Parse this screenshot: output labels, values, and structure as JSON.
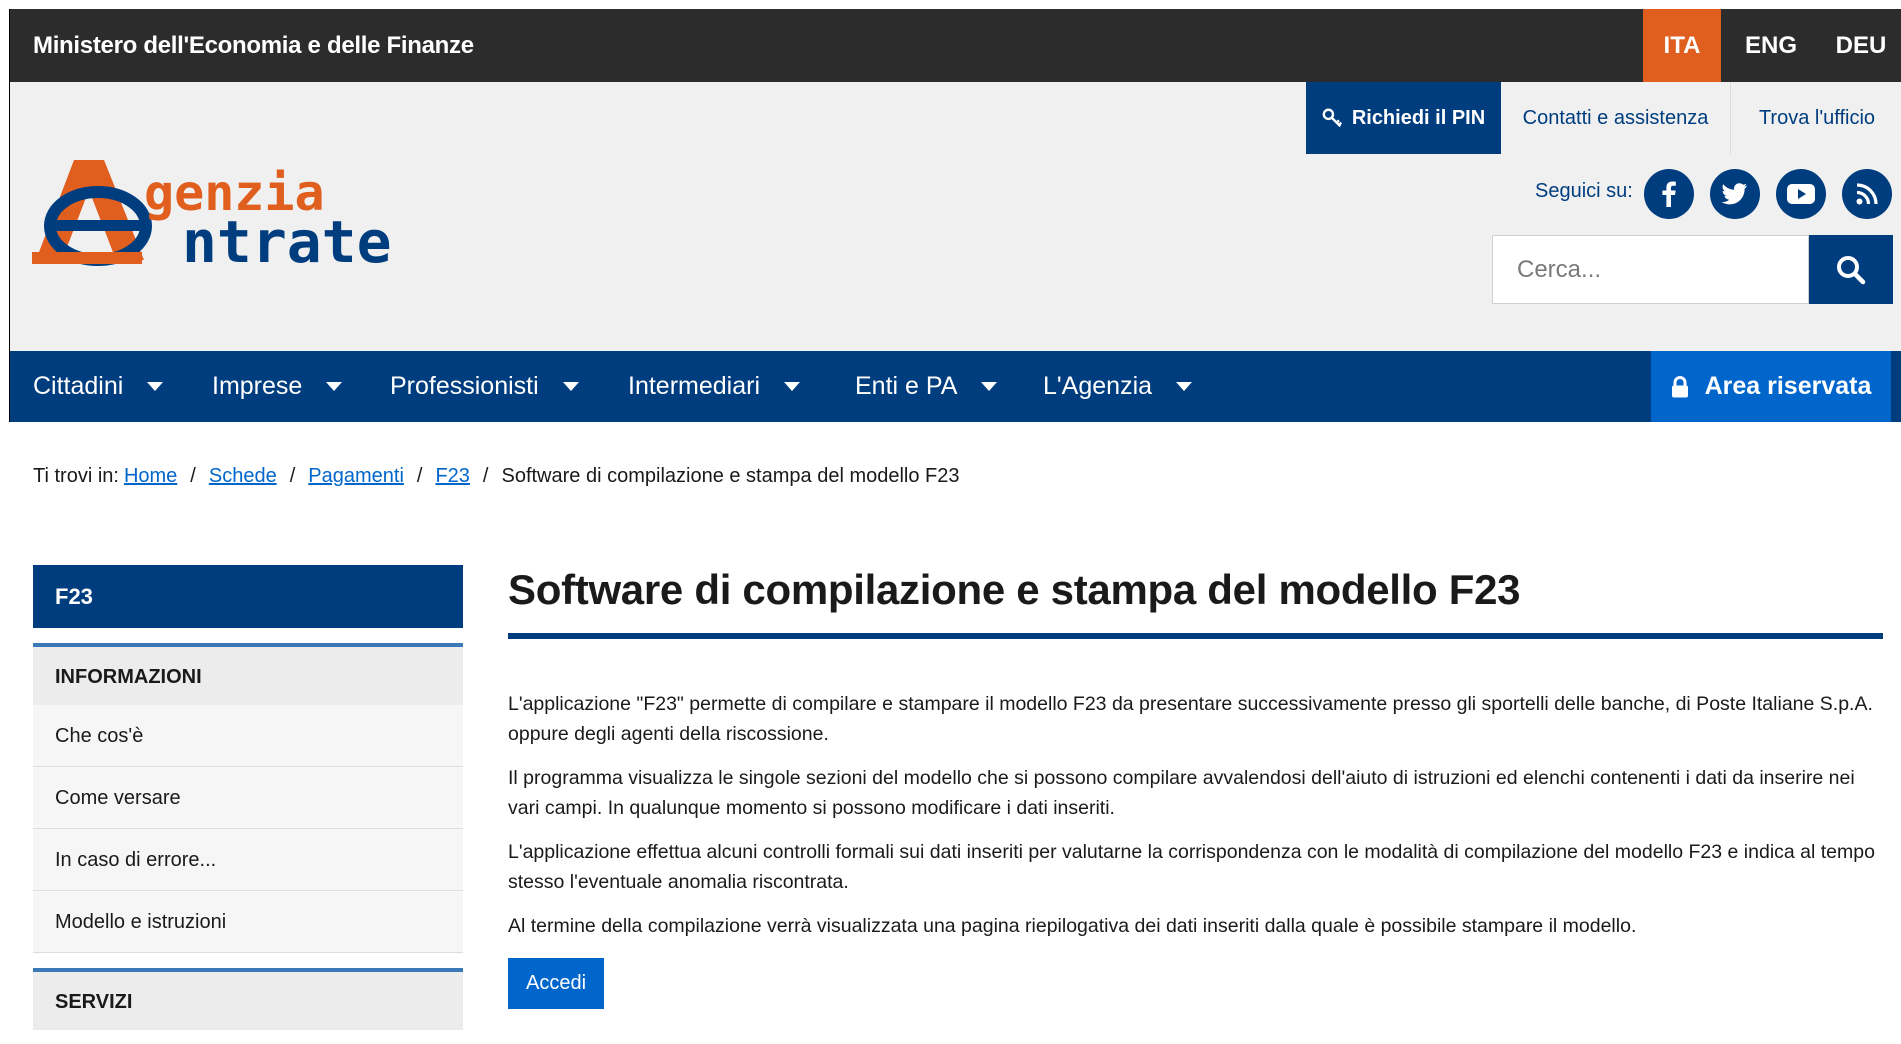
{
  "topbar": {
    "ministry": "Ministero dell'Economia e delle Finanze",
    "languages": [
      {
        "code": "ITA",
        "active": true
      },
      {
        "code": "ENG",
        "active": false
      },
      {
        "code": "DEU",
        "active": false
      }
    ]
  },
  "header": {
    "logo": {
      "line1": "genzia",
      "line2": "ntrate",
      "icon": "agenzia-entrate-logo"
    },
    "pin_button": "Richiedi il PIN",
    "contacts_link": "Contatti e assistenza",
    "office_link": "Trova l'ufficio",
    "follow_label": "Seguici su:",
    "social": [
      "facebook-icon",
      "twitter-icon",
      "youtube-icon",
      "rss-icon"
    ],
    "search": {
      "placeholder": "Cerca...",
      "value": ""
    }
  },
  "nav": {
    "items": [
      "Cittadini",
      "Imprese",
      "Professionisti",
      "Intermediari",
      "Enti e PA",
      "L'Agenzia"
    ],
    "reserved_area": "Area riservata"
  },
  "breadcrumb": {
    "prefix": "Ti trovi in:",
    "links": [
      "Home",
      "Schede",
      "Pagamenti",
      "F23"
    ],
    "current": "Software di compilazione e stampa del modello F23"
  },
  "sidebar": {
    "heading": "F23",
    "sections": [
      {
        "title": "INFORMAZIONI",
        "items": [
          "Che cos'è",
          "Come versare",
          "In caso di errore...",
          "Modello e istruzioni"
        ]
      },
      {
        "title": "SERVIZI",
        "items": []
      }
    ]
  },
  "content": {
    "title": "Software di compilazione e stampa del modello F23",
    "paragraphs": [
      "L'applicazione \"F23\" permette di compilare e stampare il modello F23 da presentare successivamente presso gli sportelli delle banche, di Poste Italiane S.p.A. oppure degli agenti della riscossione.",
      "Il programma visualizza le singole sezioni del modello che si possono compilare avvalendosi dell'aiuto di istruzioni ed elenchi contenenti i dati da inserire nei vari campi. In qualunque momento si possono modificare i dati inseriti.",
      "L'applicazione effettua alcuni controlli formali sui dati inseriti per valutarne la corrispondenza con le modalità di compilazione del modello F23 e indica al tempo stesso l'eventuale anomalia riscontrata.",
      "Al termine della compilazione verrà visualizzata una pagina riepilogativa dei dati inseriti dalla quale è possibile stampare il modello."
    ],
    "button": "Accedi"
  },
  "colors": {
    "brand_blue": "#003d7f",
    "accent_blue": "#0066cc",
    "accent_orange": "#e05e1e",
    "topbar_dark": "#2c2c2c"
  }
}
